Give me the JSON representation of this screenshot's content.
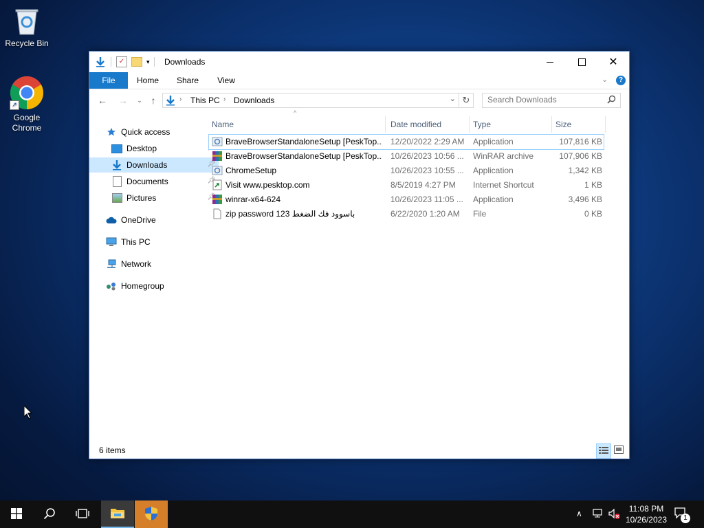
{
  "desktop": {
    "icons": [
      {
        "label": "Recycle Bin",
        "icon": "recycle-bin-icon"
      },
      {
        "label": "Google Chrome",
        "icon": "chrome-icon"
      }
    ]
  },
  "window": {
    "title": "Downloads",
    "ribbon_tabs": [
      "File",
      "Home",
      "Share",
      "View"
    ],
    "breadcrumb": [
      "This PC",
      "Downloads"
    ],
    "search_placeholder": "Search Downloads",
    "nav": [
      {
        "label": "Quick access",
        "icon": "star-icon"
      },
      {
        "label": "Desktop",
        "icon": "desktop-folder-icon",
        "pinned": true
      },
      {
        "label": "Downloads",
        "icon": "download-arrow-icon",
        "pinned": true,
        "selected": true
      },
      {
        "label": "Documents",
        "icon": "documents-icon",
        "pinned": true
      },
      {
        "label": "Pictures",
        "icon": "pictures-icon",
        "pinned": true
      },
      {
        "label": "OneDrive",
        "icon": "cloud-icon"
      },
      {
        "label": "This PC",
        "icon": "monitor-icon"
      },
      {
        "label": "Network",
        "icon": "network-icon"
      },
      {
        "label": "Homegroup",
        "icon": "homegroup-icon"
      }
    ],
    "columns": [
      "Name",
      "Date modified",
      "Type",
      "Size"
    ],
    "files": [
      {
        "name": "BraveBrowserStandaloneSetup [PeskTop....",
        "date": "12/20/2022 2:29 AM",
        "type": "Application",
        "size": "107,816 KB",
        "icon": "installer-icon"
      },
      {
        "name": "BraveBrowserStandaloneSetup [PeskTop....",
        "date": "10/26/2023 10:56 ...",
        "type": "WinRAR archive",
        "size": "107,906 KB",
        "icon": "winrar-icon"
      },
      {
        "name": "ChromeSetup",
        "date": "10/26/2023 10:55 ...",
        "type": "Application",
        "size": "1,342 KB",
        "icon": "installer-icon"
      },
      {
        "name": "Visit www.pesktop.com",
        "date": "8/5/2019 4:27 PM",
        "type": "Internet Shortcut",
        "size": "1 KB",
        "icon": "shortcut-icon"
      },
      {
        "name": "winrar-x64-624",
        "date": "10/26/2023 11:05 ...",
        "type": "Application",
        "size": "3,496 KB",
        "icon": "winrar-icon"
      },
      {
        "name": "zip password 123 باسوود فك الضغط",
        "date": "6/22/2020 1:20 AM",
        "type": "File",
        "size": "0 KB",
        "icon": "blank-file-icon"
      }
    ],
    "status": "6 items"
  },
  "taskbar": {
    "time": "11:08 PM",
    "date": "10/26/2023",
    "notification_count": "1"
  },
  "colors": {
    "accent": "#1979ca",
    "selection": "#cce8ff",
    "header_text": "#4c607a"
  }
}
